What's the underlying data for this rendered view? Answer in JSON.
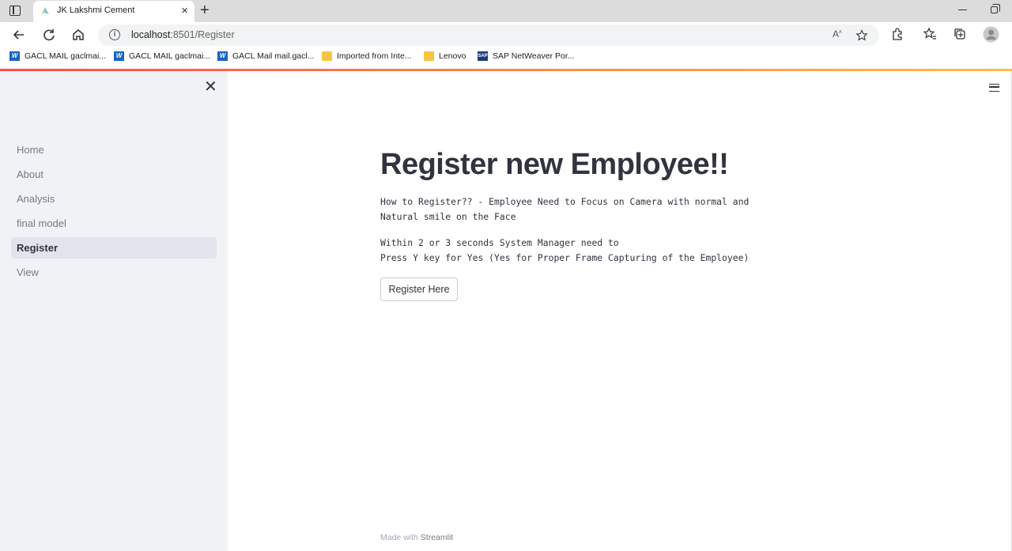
{
  "browser": {
    "tab_title": "JK Lakshmi Cement",
    "url_host": "localhost",
    "url_rest": ":8501/Register",
    "bookmarks": [
      {
        "label": "GACL MAIL gaclmai...",
        "icon": "w-icon"
      },
      {
        "label": "GACL MAIL gaclmai...",
        "icon": "w-icon"
      },
      {
        "label": "GACL Mail mail.gacl...",
        "icon": "w-icon"
      },
      {
        "label": "Imported from Inte...",
        "icon": "folder-icon"
      },
      {
        "label": "Lenovo",
        "icon": "folder-icon"
      },
      {
        "label": "SAP NetWeaver Por...",
        "icon": "sap-icon"
      }
    ]
  },
  "sidebar": {
    "items": [
      {
        "label": "Home"
      },
      {
        "label": "About"
      },
      {
        "label": "Analysis"
      },
      {
        "label": "final model"
      },
      {
        "label": "Register",
        "active": true
      },
      {
        "label": "View"
      }
    ]
  },
  "main": {
    "title": "Register new Employee!!",
    "paragraph1": "How to Register?? - Employee Need to Focus on Camera with normal and\nNatural smile on the Face",
    "paragraph2": "Within 2 or 3 seconds System Manager need to\nPress Y key for Yes (Yes for Proper Frame Capturing of the Employee)",
    "button_label": "Register Here"
  },
  "footer": {
    "prefix": "Made with ",
    "brand": "Streamlit"
  },
  "colors": {
    "accent_start": "#ff4b4b",
    "accent_end": "#ffbd45",
    "sidebar_bg": "#f0f2f6",
    "text": "#31333f"
  }
}
